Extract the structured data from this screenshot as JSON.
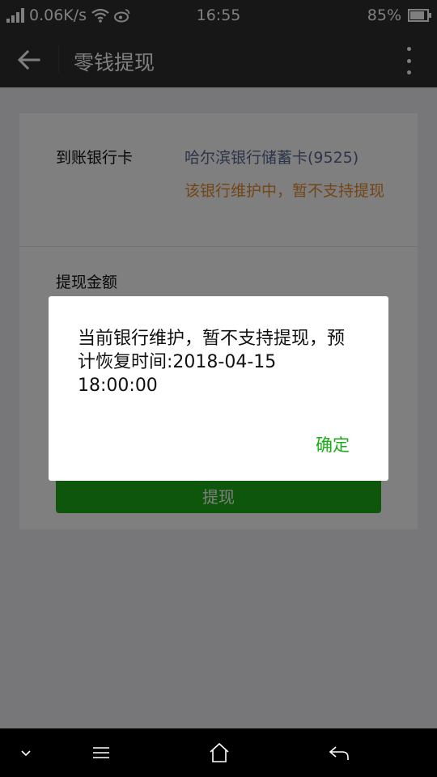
{
  "status_bar": {
    "network_speed": "0.06K/s",
    "time": "16:55",
    "battery_percent": "85%",
    "battery_level": 0.85,
    "icons": [
      "signal-icon",
      "wifi-icon",
      "weibo-icon",
      "battery-icon"
    ]
  },
  "nav": {
    "back_icon": "arrow-left-icon",
    "title": "零钱提现",
    "more_icon": "more-vertical-icon"
  },
  "form": {
    "bank_card_label": "到账银行卡",
    "bank_card_value": "哈尔滨银行储蓄卡(9525)",
    "bank_warning": "该银行维护中，暂不支持提现",
    "amount_label": "提现金额",
    "submit_label": "提现"
  },
  "dialog": {
    "message": "当前银行维护，暂不支持提现，预计恢复时间:2018-04-15 18:00:00",
    "confirm_label": "确定"
  },
  "system_nav": {
    "icons": [
      "chevron-down-icon",
      "menu-icon",
      "home-icon",
      "back-icon"
    ]
  },
  "colors": {
    "header_bg": "#2e2e30",
    "accent_green": "#1aad19",
    "link_blue": "#576b95",
    "warning_orange": "#e68a2e"
  }
}
